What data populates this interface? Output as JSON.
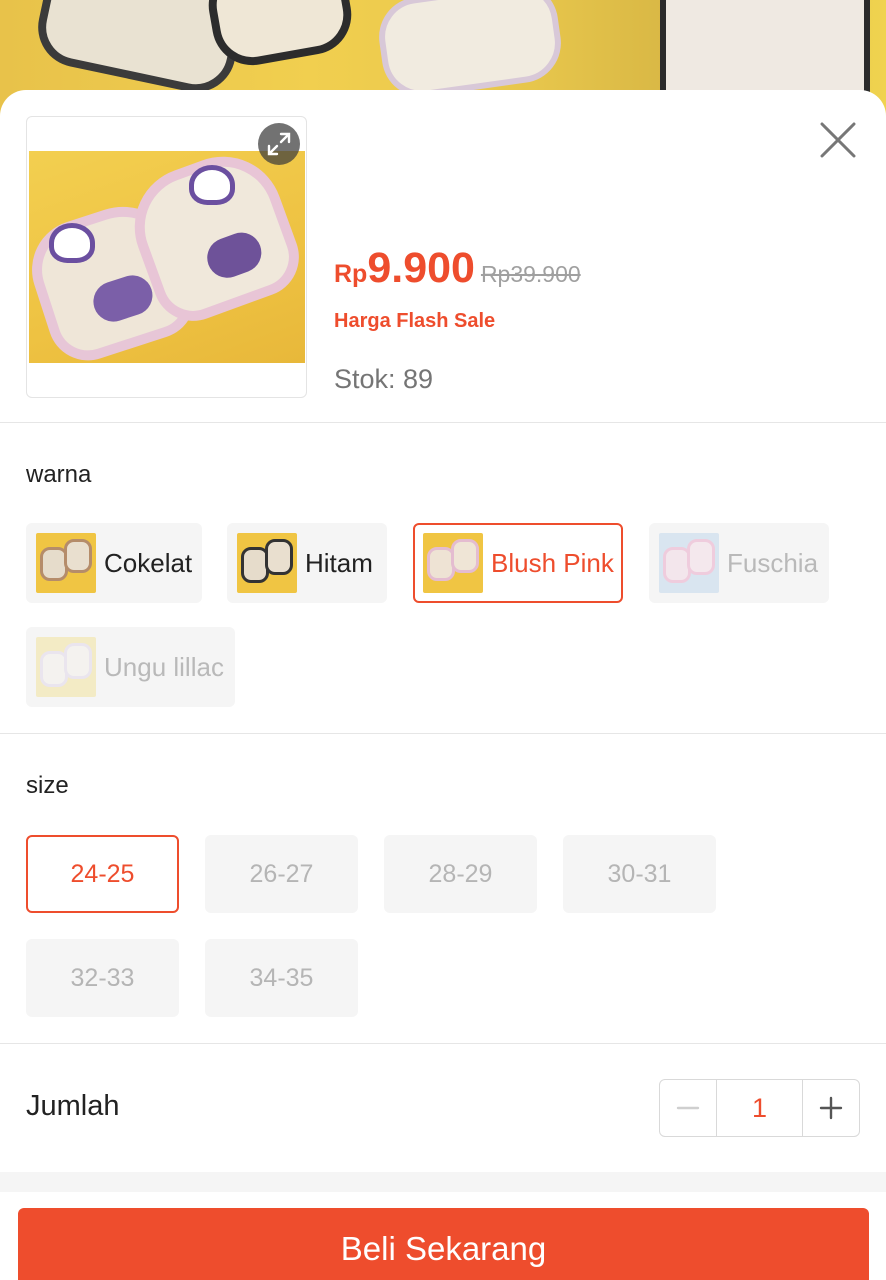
{
  "product": {
    "currency": "Rp",
    "price": "9.900",
    "original_price": "Rp39.900",
    "price_label": "Harga Flash Sale",
    "stock": "Stok: 89"
  },
  "variation_color": {
    "title": "warna",
    "options": [
      {
        "label": "Cokelat",
        "state": "available"
      },
      {
        "label": "Hitam",
        "state": "available"
      },
      {
        "label": "Blush Pink",
        "state": "selected"
      },
      {
        "label": "Fuschia",
        "state": "disabled"
      },
      {
        "label": "Ungu lillac",
        "state": "disabled"
      }
    ]
  },
  "variation_size": {
    "title": "size",
    "options": [
      {
        "label": "24-25",
        "state": "selected"
      },
      {
        "label": "26-27",
        "state": "disabled"
      },
      {
        "label": "28-29",
        "state": "disabled"
      },
      {
        "label": "30-31",
        "state": "disabled"
      },
      {
        "label": "32-33",
        "state": "disabled"
      },
      {
        "label": "34-35",
        "state": "disabled"
      }
    ]
  },
  "quantity": {
    "label": "Jumlah",
    "value": "1",
    "minus": "−",
    "plus": "+"
  },
  "actions": {
    "buy_now": "Beli Sekarang"
  },
  "colors": {
    "accent": "#ee4d2d",
    "disabled_text": "#b5b5b5",
    "chip_bg": "#f5f5f5"
  }
}
